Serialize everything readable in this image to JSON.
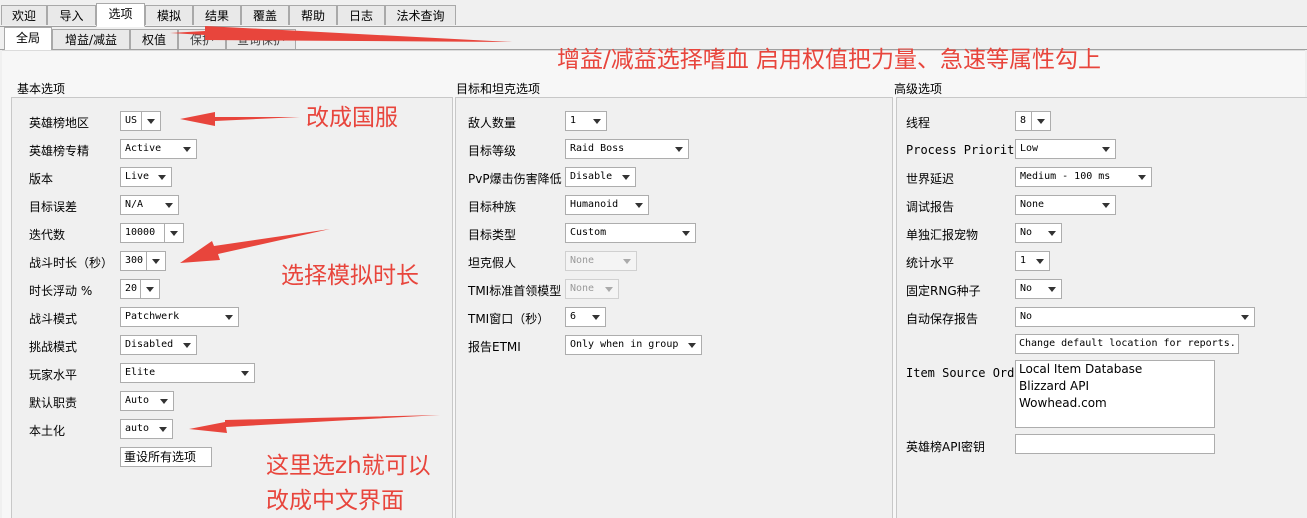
{
  "tabs": [
    "欢迎",
    "导入",
    "选项",
    "模拟",
    "结果",
    "覆盖",
    "帮助",
    "日志",
    "法术查询"
  ],
  "subtabs": [
    "全局",
    "增益/减益",
    "权值",
    "保护",
    "查询保护"
  ],
  "basic": {
    "title": "基本选项",
    "rows": [
      {
        "label": "英雄榜地区",
        "value": "US"
      },
      {
        "label": "英雄榜专精",
        "value": "Active"
      },
      {
        "label": "版本",
        "value": "Live"
      },
      {
        "label": "目标误差",
        "value": "N/A"
      },
      {
        "label": "迭代数",
        "value": "10000"
      },
      {
        "label": "战斗时长（秒）",
        "value": "300"
      },
      {
        "label": "时长浮动 %",
        "value": "20"
      },
      {
        "label": "战斗模式",
        "value": "Patchwerk"
      },
      {
        "label": "挑战模式",
        "value": "Disabled"
      },
      {
        "label": "玩家水平",
        "value": "Elite"
      },
      {
        "label": "默认职责",
        "value": "Auto"
      },
      {
        "label": "本土化",
        "value": "auto"
      }
    ],
    "reset_button": "重设所有选项"
  },
  "target": {
    "title": "目标和坦克选项",
    "rows": [
      {
        "label": "敌人数量",
        "value": "1"
      },
      {
        "label": "目标等级",
        "value": "Raid Boss"
      },
      {
        "label": "PvP爆击伤害降低",
        "value": "Disable"
      },
      {
        "label": "目标种族",
        "value": "Humanoid"
      },
      {
        "label": "目标类型",
        "value": "Custom"
      },
      {
        "label": "坦克假人",
        "value": "None"
      },
      {
        "label": "TMI标准首领模型",
        "value": "None"
      },
      {
        "label": "TMI窗口（秒）",
        "value": "6"
      },
      {
        "label": "报告ETMI",
        "value": "Only when in group"
      }
    ]
  },
  "advanced": {
    "title": "高级选项",
    "rows": [
      {
        "label": "线程",
        "value": "8"
      },
      {
        "label": "Process Priority",
        "value": "Low"
      },
      {
        "label": "世界延迟",
        "value": "Medium - 100 ms"
      },
      {
        "label": "调试报告",
        "value": "None"
      },
      {
        "label": "单独汇报宠物",
        "value": "No"
      },
      {
        "label": "统计水平",
        "value": "1"
      },
      {
        "label": "固定RNG种子",
        "value": "No"
      },
      {
        "label": "自动保存报告",
        "value": "No"
      }
    ],
    "change_location_button": "Change default location for reports.",
    "item_source_label": "Item Source Order",
    "item_sources": [
      "Local Item Database",
      "Blizzard API",
      "Wowhead.com"
    ],
    "api_key_label": "英雄榜API密钥",
    "api_key_value": ""
  },
  "annotations": {
    "buffs_note": "增益/减益选择嗜血   启用权值把力量、急速等属性勾上",
    "region_note": "改成国服",
    "duration_note": "选择模拟时长",
    "locale_note_1": "这里选zh就可以",
    "locale_note_2": "改成中文界面"
  },
  "colors": {
    "annotation": "#e8453c"
  }
}
